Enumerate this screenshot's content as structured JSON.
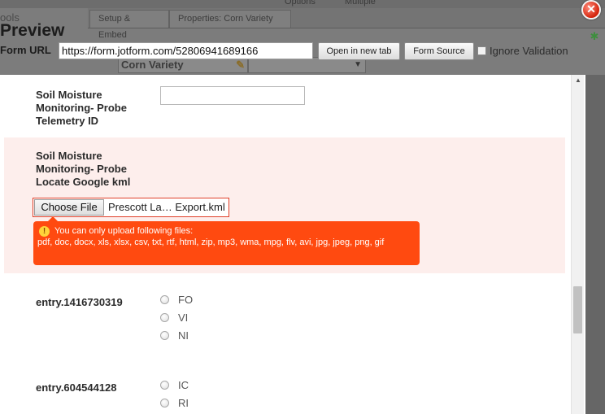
{
  "background": {
    "top_left_text": "ools",
    "top_options": "Options",
    "top_multiple": "Multiple",
    "tabs": [
      "Setup & Embed",
      "Properties: Corn Variety"
    ],
    "field_label": "Corn Variety",
    "dropdown_arrow": "▼"
  },
  "preview": {
    "title": "Preview",
    "form_url_label": "Form URL",
    "form_url_value": "https://form.jotform.com/52806941689166",
    "open_new_tab_label": "Open in new tab",
    "form_source_label": "Form Source",
    "ignore_validation_label": "Ignore Validation",
    "close_glyph": "✕"
  },
  "form": {
    "q1_label": "Soil Moisture Monitoring- Probe Telemetry ID",
    "q1_value": "",
    "q2_label": "Soil Moisture Monitoring- Probe Locate Google kml",
    "choose_file_label": "Choose File",
    "file_name": "Prescott La… Export.kml",
    "error_line1": "You can only upload following files:",
    "error_line2": "pdf, doc, docx, xls, xlsx, csv, txt, rtf, html, zip, mp3, wma, mpg, flv, avi, jpg, jpeg, png, gif",
    "entry1_label": "entry.1416730319",
    "entry1_options": [
      "FO",
      "VI",
      "NI"
    ],
    "entry2_label": "entry.604544128",
    "entry2_options": [
      "IC",
      "RI"
    ]
  },
  "colors": {
    "error_bubble": "#ff4a10",
    "error_section_bg": "#fdeeec",
    "file_border": "#e0402a",
    "close_button": "#d3240c"
  },
  "icons": [
    "close-icon",
    "warning-icon",
    "pencil-icon",
    "scroll-up-icon",
    "puzzle-icon"
  ]
}
